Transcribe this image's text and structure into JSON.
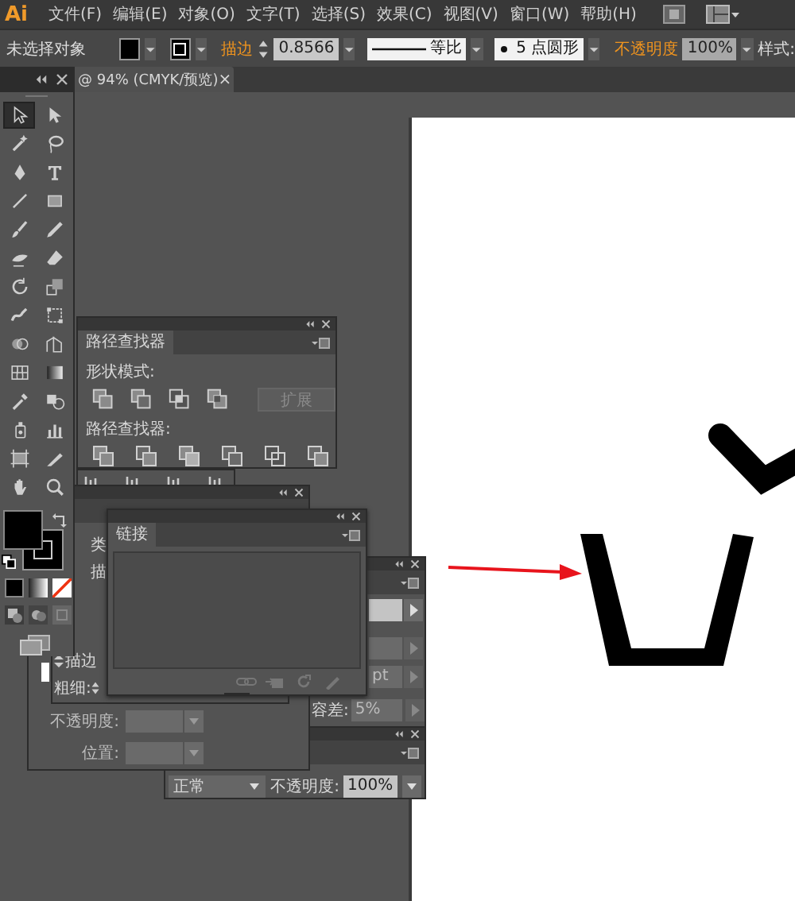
{
  "menu_bar": {
    "logo": "Ai",
    "items": [
      "文件(F)",
      "编辑(E)",
      "对象(O)",
      "文字(T)",
      "选择(S)",
      "效果(C)",
      "视图(V)",
      "窗口(W)",
      "帮助(H)"
    ]
  },
  "control_bar": {
    "selection": "未选择对象",
    "stroke_label": "描边",
    "stroke_weight": "0.8566",
    "stroke_profile": "等比",
    "brush": "5 点圆形",
    "opacity_label": "不透明度",
    "opacity": "100%",
    "style_label": "样式:"
  },
  "document_tab": {
    "title": "@ 94% (CMYK/预览)",
    "close": "×"
  },
  "tools": [
    {
      "selected": true
    },
    {
      "selected": false
    },
    {
      "selected": false
    },
    {
      "selected": false
    },
    {
      "selected": false
    },
    {
      "selected": false
    },
    {
      "selected": false
    },
    {
      "selected": false
    },
    {
      "selected": false
    },
    {
      "selected": false
    },
    {
      "selected": false
    },
    {
      "selected": false
    },
    {
      "selected": false
    },
    {
      "selected": false
    },
    {
      "selected": false
    },
    {
      "selected": false
    },
    {
      "selected": false
    },
    {
      "selected": false
    },
    {
      "selected": false
    },
    {
      "selected": false
    },
    {
      "selected": false
    },
    {
      "selected": false
    },
    {
      "selected": false
    },
    {
      "selected": false
    },
    {
      "selected": false
    },
    {
      "selected": false
    },
    {
      "selected": false
    },
    {
      "selected": false
    }
  ],
  "pathfinder_panel": {
    "tab": "路径查找器",
    "shape_modes_label": "形状模式:",
    "expand_button": {
      "label": "扩展",
      "disabled": true
    },
    "pathfinders_label": "路径查找器:"
  },
  "gradient_panel": {
    "type_label": "类",
    "stroke_label": "描",
    "opacity_label": "不透明度:",
    "location_label": "位置:"
  },
  "stroke_panel": {
    "tab": "描边",
    "weight_label": "粗细:"
  },
  "links_panel": {
    "tab": "链接"
  },
  "side_panel": {
    "unit": "pt",
    "tolerance_label": "容差:",
    "tolerance": "5%"
  },
  "transparency_panel": {
    "blend_mode": "正常",
    "opacity_label": "不透明度:",
    "opacity": "100%"
  }
}
